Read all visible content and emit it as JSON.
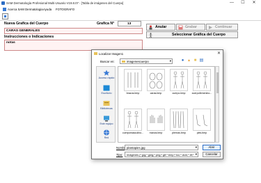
{
  "window": {
    "title": "SAM Dermatología Profesional Multi-Usuario V19.8.07 - [Tabla de imágenes del Cuerpo]",
    "minimize": "—",
    "maximize": "☐",
    "close": "✕"
  },
  "menu": {
    "items": [
      "Acerca SAM Dermatologia",
      "Ayuda",
      "FOTOGRAFO"
    ]
  },
  "form": {
    "new_graphic_label": "Nueva Grafica del Cuerpo",
    "graphic_no_label": "Grafica N°",
    "graphic_no_value": "13",
    "name_value": "CARAS GENERALES",
    "instructions_label": "Instrucciones o Indicaciones",
    "notes_value": "notas"
  },
  "buttons": {
    "cancel": "Anular",
    "save": "Grabar",
    "continue": "Continuar",
    "select_graphic": "Seleccionar Gráfica del Cuerpo"
  },
  "dialog": {
    "title": "Localizar Imagen1",
    "look_in_label": "Buscar en:",
    "look_in_value": "imagenescuerpo",
    "places": [
      "Acceso rápido",
      "Escritorio",
      "Bibliotecas",
      "Este equipo",
      "Red"
    ],
    "files": [
      "brazos.bmp",
      "caras.bmp",
      "cuerpo.bmp",
      "cuerpofemenino...",
      "cuerpomasculino...",
      "manos.bmp",
      "piernas.bmp",
      "pies.bmp"
    ],
    "filename_label": "Nombre:",
    "filename_value": "plantapies.jpg",
    "type_label": "Tipo:",
    "type_value": "Imágenes (*.jpg;*.jpeg;*.png;*.gif;*.bmp;*.tcc;*.dcm;*.tif;*.tiff)",
    "open_button": "Abrir",
    "cancel_button": "Cancelar"
  },
  "colors": {
    "pink_field": "#fff3f3",
    "accent_blue": "#2b6cc4",
    "folder_yellow": "#e8c35a"
  }
}
